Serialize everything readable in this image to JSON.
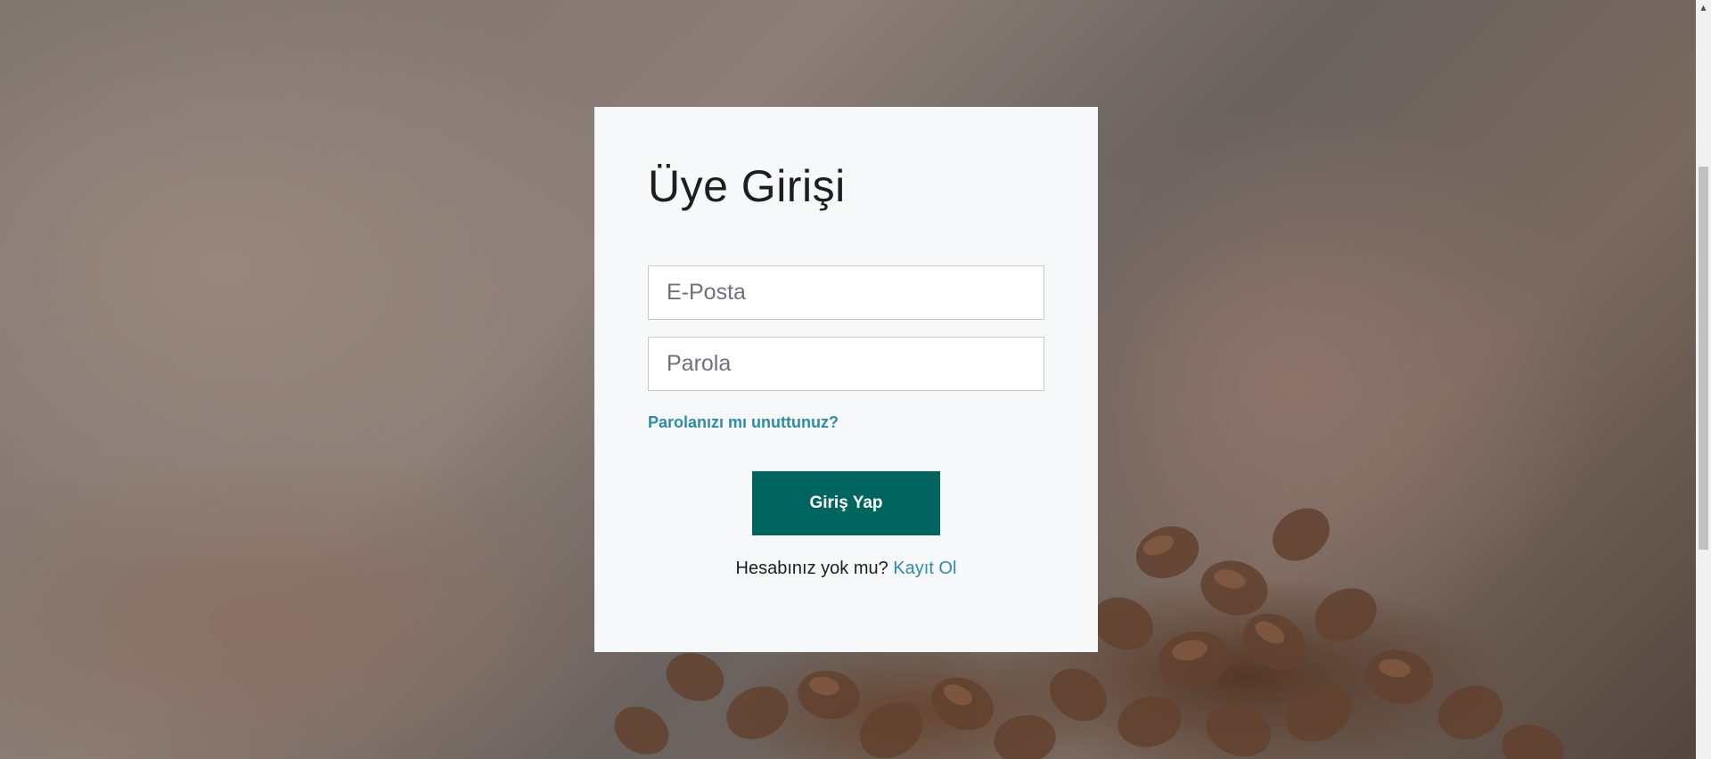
{
  "login_card": {
    "title": "Üye Girişi",
    "email_placeholder": "E-Posta",
    "password_placeholder": "Parola",
    "forgot_password_label": "Parolanızı mı unuttunuz?",
    "submit_label": "Giriş Yap",
    "signup_prompt": "Hesabınız yok mu?",
    "signup_label": "Kayıt Ol"
  },
  "colors": {
    "accent_button": "#00645f",
    "link": "#2e8ca4",
    "card_background": "#f7f8f9"
  },
  "icons": {
    "scroll_up": "scroll-up-arrow-icon"
  }
}
